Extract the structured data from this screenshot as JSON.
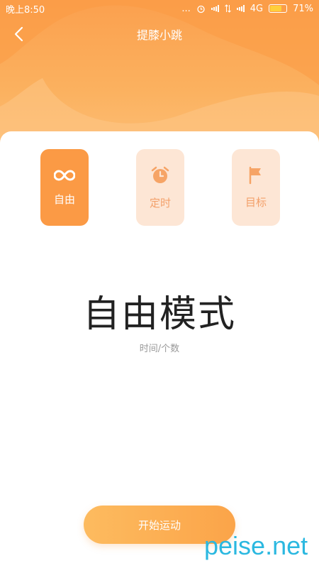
{
  "status_bar": {
    "time": "晚上8:50",
    "dots": "...",
    "network": "4G",
    "battery": "71%",
    "battery_level": 0.71
  },
  "header": {
    "title": "提膝小跳",
    "back_icon": "chevron-left-icon"
  },
  "modes": [
    {
      "label": "自由",
      "icon": "infinity-icon",
      "active": true
    },
    {
      "label": "定时",
      "icon": "alarm-clock-icon",
      "active": false
    },
    {
      "label": "目标",
      "icon": "flag-icon",
      "active": false
    }
  ],
  "main": {
    "mode_title": "自由模式",
    "mode_subtitle": "时间/个数"
  },
  "start_button": {
    "label": "开始运动"
  },
  "watermark": {
    "text": "peise.net"
  },
  "colors": {
    "accent": "#fb9a45",
    "inactive_bg": "#fde6d5",
    "inactive_fg": "#f3a06a",
    "watermark": "#2bb8e0"
  }
}
